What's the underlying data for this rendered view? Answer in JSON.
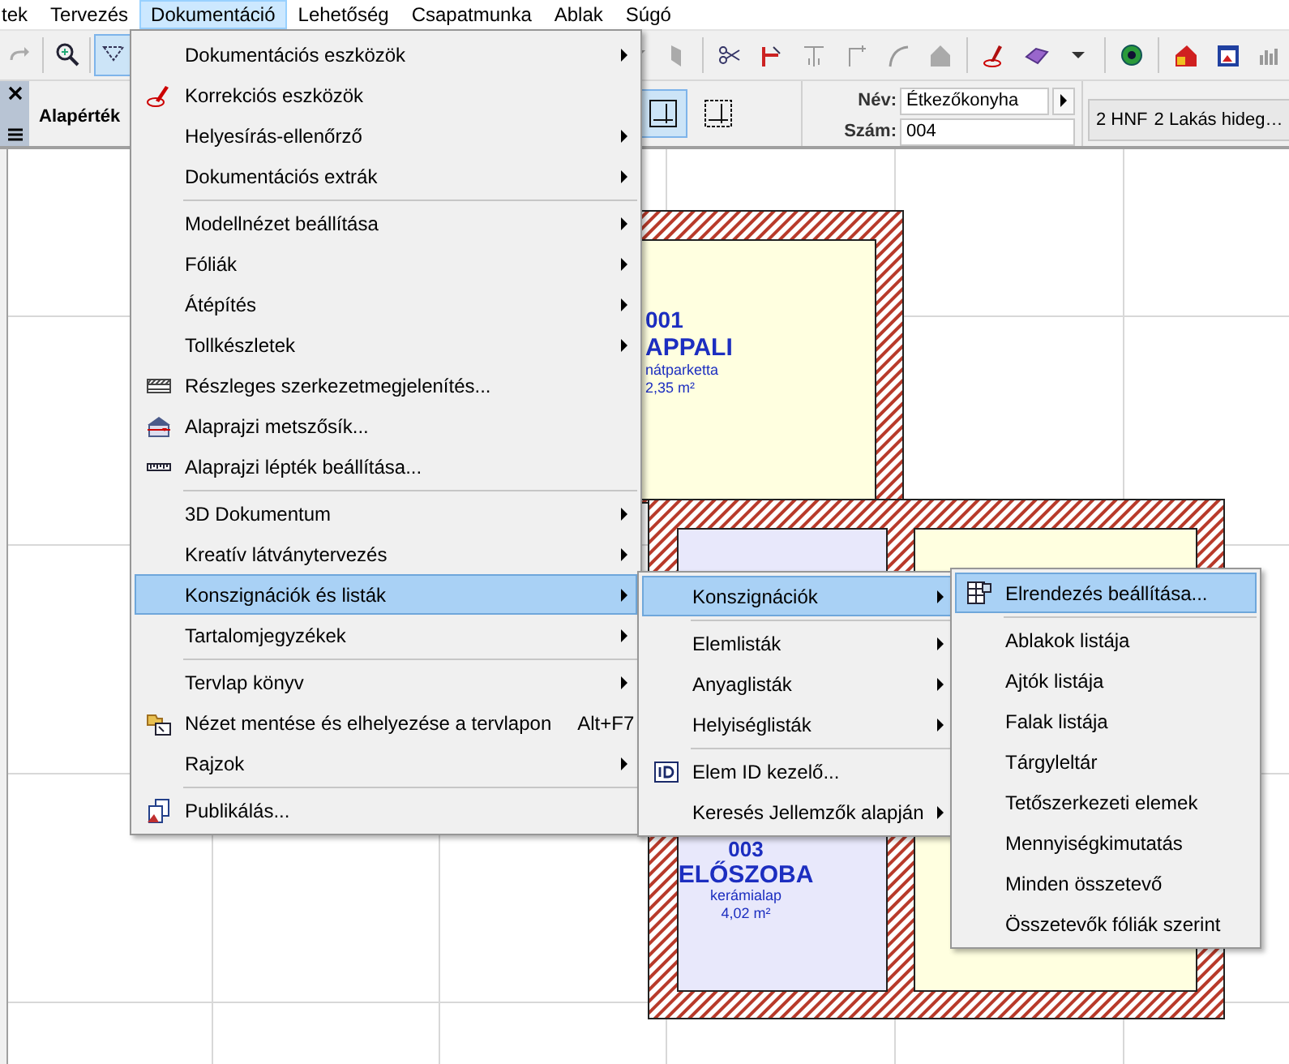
{
  "menubar": [
    {
      "label": "tek",
      "selected": false
    },
    {
      "label": "Tervezés",
      "selected": false
    },
    {
      "label": "Dokumentáció",
      "selected": true
    },
    {
      "label": "Lehetőség",
      "selected": false
    },
    {
      "label": "Csapatmunka",
      "selected": false
    },
    {
      "label": "Ablak",
      "selected": false
    },
    {
      "label": "Súgó",
      "selected": false
    }
  ],
  "toolbar": {
    "tools": [
      {
        "selected": false
      },
      {
        "selected": false
      },
      {
        "selected": true
      }
    ]
  },
  "infobox": {
    "default_label": "Alapérték",
    "geometry_options": [
      {
        "selected": true
      },
      {
        "selected": false
      }
    ],
    "name_label": "Név:",
    "name_value": "Étkezőkonyha",
    "number_label": "Szám:",
    "number_value": "004",
    "zone_code": "2 HNF",
    "zone_name": "2 Lakás hideg…"
  },
  "rooms": [
    {
      "number": "001",
      "name": "APPALI",
      "material": "nátparketta",
      "area": "2,35 m²"
    },
    {
      "number": "003",
      "name": "ELŐSZOBA",
      "material": "kerámialap",
      "area": "4,02 m²"
    }
  ],
  "menus": [
    {
      "items": [
        {
          "kind": "item",
          "label": "Dokumentációs eszközök",
          "submenu": true,
          "selected": false
        },
        {
          "kind": "item",
          "label": "Korrekciós eszközök",
          "submenu": false,
          "selected": false
        },
        {
          "kind": "item",
          "label": "Helyesírás-ellenőrző",
          "submenu": true,
          "selected": false
        },
        {
          "kind": "item",
          "label": "Dokumentációs extrák",
          "submenu": true,
          "selected": false
        },
        {
          "kind": "separator"
        },
        {
          "kind": "item",
          "label": "Modellnézet beállítása",
          "submenu": true,
          "selected": false
        },
        {
          "kind": "item",
          "label": "Fóliák",
          "submenu": true,
          "selected": false
        },
        {
          "kind": "item",
          "label": "Átépítés",
          "submenu": true,
          "selected": false
        },
        {
          "kind": "item",
          "label": "Tollkészletek",
          "submenu": true,
          "selected": false
        },
        {
          "kind": "item",
          "label": "Részleges szerkezetmegjelenítés...",
          "submenu": false,
          "selected": false
        },
        {
          "kind": "item",
          "label": "Alaprajzi metszősík...",
          "submenu": false,
          "selected": false
        },
        {
          "kind": "item",
          "label": "Alaprajzi lépték beállítása...",
          "submenu": false,
          "selected": false
        },
        {
          "kind": "separator"
        },
        {
          "kind": "item",
          "label": "3D Dokumentum",
          "submenu": true,
          "selected": false
        },
        {
          "kind": "item",
          "label": "Kreatív látványtervezés",
          "submenu": true,
          "selected": false
        },
        {
          "kind": "item",
          "label": "Konszignációk és listák",
          "submenu": true,
          "selected": true
        },
        {
          "kind": "item",
          "label": "Tartalomjegyzékek",
          "submenu": true,
          "selected": false
        },
        {
          "kind": "separator"
        },
        {
          "kind": "item",
          "label": "Tervlap könyv",
          "submenu": true,
          "selected": false
        },
        {
          "kind": "item",
          "label": "Nézet mentése és elhelyezése a tervlapon",
          "shortcut": "Alt+F7",
          "submenu": false,
          "selected": false
        },
        {
          "kind": "item",
          "label": "Rajzok",
          "submenu": true,
          "selected": false
        },
        {
          "kind": "separator"
        },
        {
          "kind": "item",
          "label": "Publikálás...",
          "submenu": false,
          "selected": false
        }
      ]
    },
    {
      "items": [
        {
          "kind": "item",
          "label": "Konszignációk",
          "submenu": true,
          "selected": true
        },
        {
          "kind": "separator"
        },
        {
          "kind": "item",
          "label": "Elemlisták",
          "submenu": true,
          "selected": false
        },
        {
          "kind": "item",
          "label": "Anyaglisták",
          "submenu": true,
          "selected": false
        },
        {
          "kind": "item",
          "label": "Helyiséglisták",
          "submenu": true,
          "selected": false
        },
        {
          "kind": "separator"
        },
        {
          "kind": "item",
          "label": "Elem ID kezelő...",
          "submenu": false,
          "selected": false
        },
        {
          "kind": "item",
          "label": "Keresés Jellemzők alapján",
          "submenu": true,
          "selected": false
        }
      ]
    },
    {
      "items": [
        {
          "kind": "item",
          "label": "Elrendezés beállítása...",
          "submenu": false,
          "selected": true
        },
        {
          "kind": "separator"
        },
        {
          "kind": "item",
          "label": "Ablakok listája",
          "submenu": false,
          "selected": false
        },
        {
          "kind": "item",
          "label": "Ajtók listája",
          "submenu": false,
          "selected": false
        },
        {
          "kind": "item",
          "label": "Falak listája",
          "submenu": false,
          "selected": false
        },
        {
          "kind": "item",
          "label": "Tárgyleltár",
          "submenu": false,
          "selected": false
        },
        {
          "kind": "item",
          "label": "Tetőszerkezeti elemek",
          "submenu": false,
          "selected": false
        },
        {
          "kind": "item",
          "label": "Mennyiségkimutatás",
          "submenu": false,
          "selected": false
        },
        {
          "kind": "item",
          "label": "Minden összetevő",
          "submenu": false,
          "selected": false
        },
        {
          "kind": "item",
          "label": "Összetevők fóliák szerint",
          "submenu": false,
          "selected": false
        }
      ]
    }
  ]
}
